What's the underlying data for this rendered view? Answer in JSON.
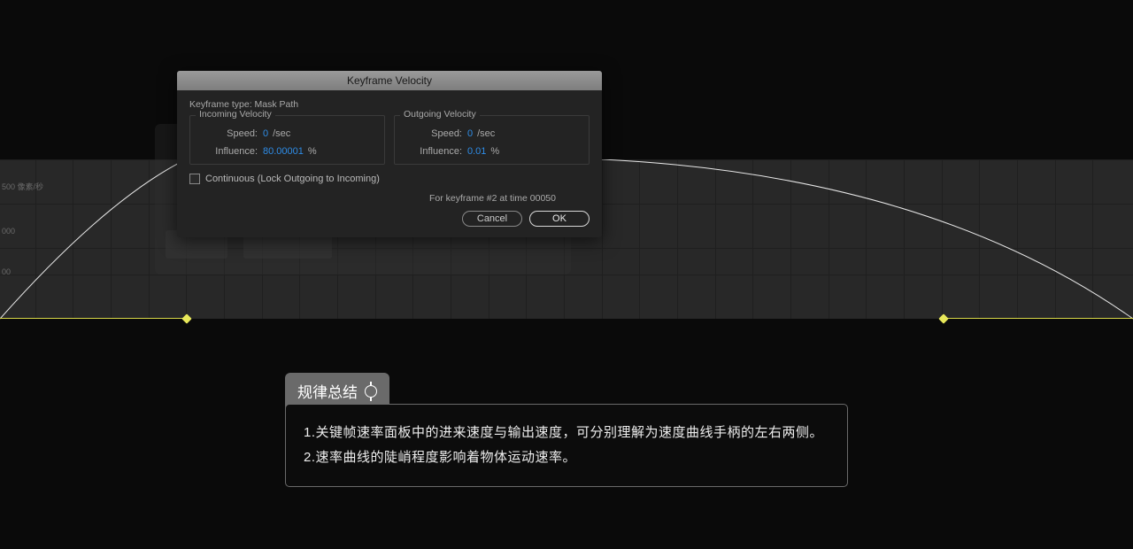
{
  "graph": {
    "axis_labels": {
      "top": "500 像素/秒",
      "mid": "000",
      "bot": "00"
    }
  },
  "dialog": {
    "title": "Keyframe Velocity",
    "keyframe_type_label": "Keyframe type:",
    "keyframe_type_value": "Mask Path",
    "incoming": {
      "title": "Incoming Velocity",
      "speed_label": "Speed:",
      "speed_value": "0",
      "speed_unit": "/sec",
      "influence_label": "Influence:",
      "influence_value": "80.00001",
      "influence_unit": "%"
    },
    "outgoing": {
      "title": "Outgoing Velocity",
      "speed_label": "Speed:",
      "speed_value": "0",
      "speed_unit": "/sec",
      "influence_label": "Influence:",
      "influence_value": "0.01",
      "influence_unit": "%"
    },
    "continuous_label": "Continuous (Lock Outgoing to Incoming)",
    "info": "For keyframe #2 at time 00050",
    "cancel": "Cancel",
    "ok": "OK"
  },
  "summary": {
    "tab": "规律总结",
    "line1": "1.关键帧速率面板中的进来速度与输出速度，可分别理解为速度曲线手柄的左右两侧。",
    "line2": "2.速率曲线的陡峭程度影响着物体运动速率。"
  }
}
